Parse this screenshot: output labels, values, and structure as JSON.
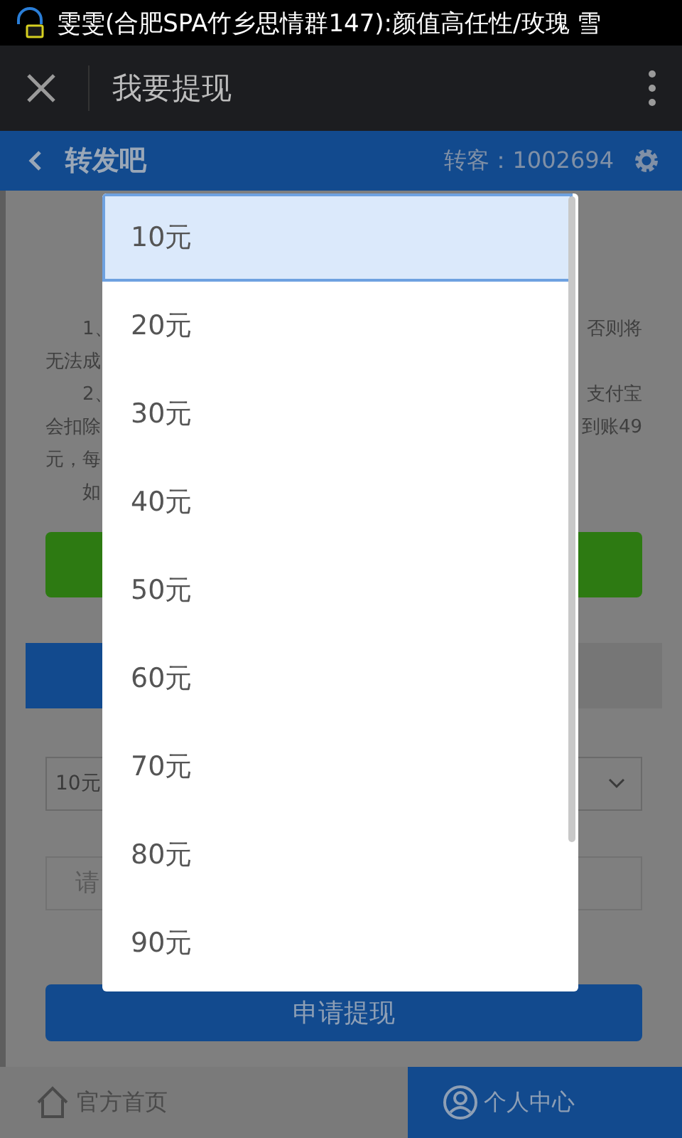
{
  "status_bar": {
    "notification": "雯雯(合肥SPA竹乡思情群147):颜值高任性/玫瑰 雪"
  },
  "title_bar": {
    "title": "我要提现"
  },
  "header": {
    "title": "转发吧",
    "account": "转客：1002694"
  },
  "notice": {
    "rows": [
      {
        "left": "1、",
        "right": "否则将",
        "indent": true
      },
      {
        "left": "无法成",
        "right": "",
        "indent": false
      },
      {
        "left": "2、",
        "right": "支付宝",
        "indent": true
      },
      {
        "left": "会扣除",
        "right": "到账49",
        "indent": false
      },
      {
        "left": "元，每",
        "right": "",
        "indent": false
      },
      {
        "left": "如",
        "right": "",
        "indent": true
      }
    ]
  },
  "tabs": [
    {
      "selected": true
    },
    {
      "selected": false
    }
  ],
  "amount_select": {
    "value": "10元"
  },
  "amount_input": {
    "placeholder": "请"
  },
  "submit_button": {
    "label": "申请提现"
  },
  "footer": [
    {
      "label": "官方首页",
      "kind": "home",
      "selected": false
    },
    {
      "label": "个人中心",
      "kind": "user",
      "selected": true
    }
  ],
  "dropdown": {
    "options": [
      {
        "label": "10元",
        "selected": true
      },
      {
        "label": "20元",
        "selected": false
      },
      {
        "label": "30元",
        "selected": false
      },
      {
        "label": "40元",
        "selected": false
      },
      {
        "label": "50元",
        "selected": false
      },
      {
        "label": "60元",
        "selected": false
      },
      {
        "label": "70元",
        "selected": false
      },
      {
        "label": "80元",
        "selected": false
      },
      {
        "label": "90元",
        "selected": false
      }
    ]
  }
}
